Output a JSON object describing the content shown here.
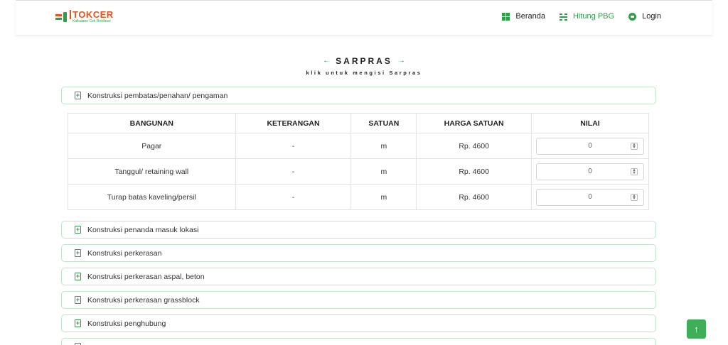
{
  "brand": {
    "name": "TOKCER",
    "tagline": "Kalkulator Cek Retribusi"
  },
  "nav": {
    "home": "Beranda",
    "calc": "Hitung PBG",
    "login": "Login"
  },
  "section": {
    "title": "SARPRAS",
    "subtitle": "klik untuk mengisi Sarpras"
  },
  "accordions": [
    "Konstruksi pembatas/penahan/ pengaman",
    "Konstruksi penanda masuk lokasi",
    "Konstruksi perkerasan",
    "Konstruksi perkerasan aspal, beton",
    "Konstruksi perkerasan grassblock",
    "Konstruksi penghubung"
  ],
  "table": {
    "headers": [
      "BANGUNAN",
      "KETERANGAN",
      "SATUAN",
      "HARGA SATUAN",
      "NILAI"
    ],
    "rows": [
      {
        "bangunan": "Pagar",
        "keterangan": "-",
        "satuan": "m",
        "harga": "Rp. 4600",
        "nilai": "0"
      },
      {
        "bangunan": "Tanggul/ retaining wall",
        "keterangan": "-",
        "satuan": "m",
        "harga": "Rp. 4600",
        "nilai": "0"
      },
      {
        "bangunan": "Turap batas kaveling/persil",
        "keterangan": "-",
        "satuan": "m",
        "harga": "Rp. 4600",
        "nilai": "0"
      }
    ]
  },
  "colors": {
    "accent": "#2e9e48",
    "brand_orange": "#e8501e"
  }
}
